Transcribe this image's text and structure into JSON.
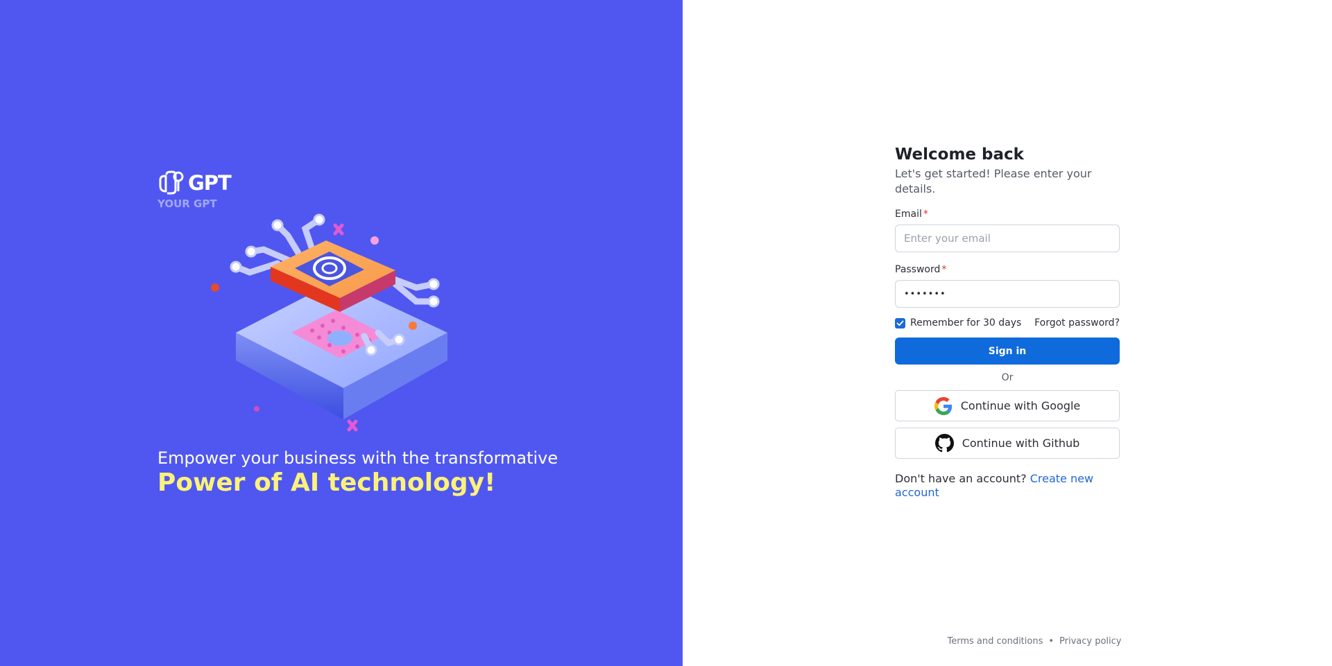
{
  "brand": {
    "name": "GPT",
    "subtitle": "YOUR GPT"
  },
  "hero": {
    "tagline_line1": "Empower your business with the transformative",
    "tagline_line2": "Power of AI technology!"
  },
  "form": {
    "title": "Welcome back",
    "subtitle": "Let's get started! Please enter your details.",
    "email_label": "Email",
    "email_required_mark": "*",
    "email_placeholder": "Enter your email",
    "email_value": "",
    "password_label": "Password",
    "password_required_mark": "*",
    "password_value": "•••••••",
    "remember_label": "Remember for 30 days",
    "remember_checked": true,
    "forgot_label": "Forgot password?",
    "signin_label": "Sign in",
    "or_label": "Or",
    "google_label": "Continue with Google",
    "github_label": "Continue with Github",
    "signup_prompt": "Don't have an account?",
    "signup_link": "Create new account"
  },
  "footer": {
    "terms": "Terms and conditions",
    "separator": "•",
    "privacy": "Privacy policy"
  },
  "colors": {
    "left_panel": "#5057f0",
    "accent_yellow": "#fbf279",
    "primary_button": "#0f6bdc",
    "link": "#2167d8"
  },
  "icons": {
    "brand": "gpt-logo-icon",
    "checkbox": "check-icon",
    "google": "google-icon",
    "github": "github-icon"
  }
}
